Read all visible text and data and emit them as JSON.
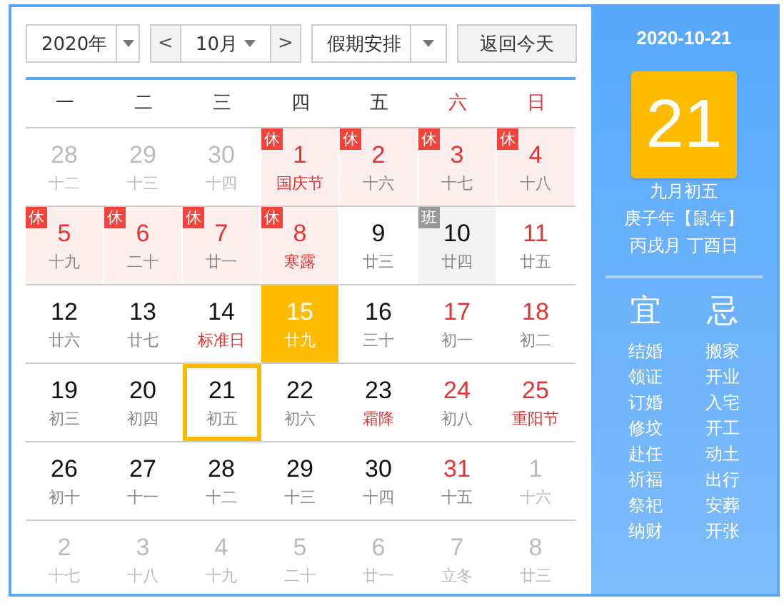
{
  "toolbar": {
    "year": "2020年",
    "prev": "<",
    "month": "10月",
    "next": ">",
    "holiday_select": "假期安排",
    "today_button": "返回今天"
  },
  "weekdays": [
    {
      "label": "一",
      "weekend": false
    },
    {
      "label": "二",
      "weekend": false
    },
    {
      "label": "三",
      "weekend": false
    },
    {
      "label": "四",
      "weekend": false
    },
    {
      "label": "五",
      "weekend": false
    },
    {
      "label": "六",
      "weekend": true
    },
    {
      "label": "日",
      "weekend": true
    }
  ],
  "weeks": [
    [
      {
        "day": "28",
        "lunar": "十二",
        "muted": true,
        "today": false,
        "selected": false
      },
      {
        "day": "29",
        "lunar": "十三",
        "muted": true,
        "today": false,
        "selected": false
      },
      {
        "day": "30",
        "lunar": "十四",
        "muted": true,
        "today": false,
        "selected": false
      },
      {
        "day": "1",
        "lunar": "国庆节",
        "muted": false,
        "rest_day": true,
        "festival": true,
        "badge": {
          "kind": "rest",
          "text": "休"
        },
        "today": false,
        "selected": false
      },
      {
        "day": "2",
        "lunar": "十六",
        "muted": false,
        "rest_day": true,
        "festival": false,
        "badge": {
          "kind": "rest",
          "text": "休"
        },
        "today": false,
        "selected": false
      },
      {
        "day": "3",
        "lunar": "十七",
        "muted": false,
        "rest_day": true,
        "festival": false,
        "badge": {
          "kind": "rest",
          "text": "休"
        },
        "today": false,
        "selected": false
      },
      {
        "day": "4",
        "lunar": "十八",
        "muted": false,
        "rest_day": true,
        "festival": false,
        "badge": {
          "kind": "rest",
          "text": "休"
        },
        "today": false,
        "selected": false
      }
    ],
    [
      {
        "day": "5",
        "lunar": "十九",
        "muted": false,
        "rest_day": true,
        "festival": false,
        "badge": {
          "kind": "rest",
          "text": "休"
        },
        "today": false,
        "selected": false
      },
      {
        "day": "6",
        "lunar": "二十",
        "muted": false,
        "rest_day": true,
        "festival": false,
        "badge": {
          "kind": "rest",
          "text": "休"
        },
        "today": false,
        "selected": false
      },
      {
        "day": "7",
        "lunar": "廿一",
        "muted": false,
        "rest_day": true,
        "festival": false,
        "badge": {
          "kind": "rest",
          "text": "休"
        },
        "today": false,
        "selected": false
      },
      {
        "day": "8",
        "lunar": "寒露",
        "muted": false,
        "rest_day": true,
        "festival": true,
        "badge": {
          "kind": "rest",
          "text": "休"
        },
        "today": false,
        "selected": false
      },
      {
        "day": "9",
        "lunar": "廿三",
        "muted": false,
        "rest_day": false,
        "festival": false,
        "today": false,
        "selected": false
      },
      {
        "day": "10",
        "lunar": "廿四",
        "muted": false,
        "rest_day": false,
        "festival": false,
        "badge": {
          "kind": "work",
          "text": "班"
        },
        "today": false,
        "selected": false
      },
      {
        "day": "11",
        "lunar": "廿五",
        "muted": false,
        "rest_day": true,
        "festival": false,
        "today": false,
        "selected": false
      }
    ],
    [
      {
        "day": "12",
        "lunar": "廿六",
        "muted": false,
        "rest_day": false,
        "festival": false,
        "today": false,
        "selected": false
      },
      {
        "day": "13",
        "lunar": "廿七",
        "muted": false,
        "rest_day": false,
        "festival": false,
        "today": false,
        "selected": false
      },
      {
        "day": "14",
        "lunar": "标准日",
        "muted": false,
        "rest_day": false,
        "festival": true,
        "today": false,
        "selected": false
      },
      {
        "day": "15",
        "lunar": "廿九",
        "muted": false,
        "today": true,
        "selected": false
      },
      {
        "day": "16",
        "lunar": "三十",
        "muted": false,
        "rest_day": false,
        "festival": false,
        "today": false,
        "selected": false
      },
      {
        "day": "17",
        "lunar": "初一",
        "muted": false,
        "rest_day": true,
        "festival": false,
        "today": false,
        "selected": false
      },
      {
        "day": "18",
        "lunar": "初二",
        "muted": false,
        "rest_day": true,
        "festival": false,
        "today": false,
        "selected": false
      }
    ],
    [
      {
        "day": "19",
        "lunar": "初三",
        "muted": false,
        "rest_day": false,
        "festival": false,
        "today": false,
        "selected": false
      },
      {
        "day": "20",
        "lunar": "初四",
        "muted": false,
        "rest_day": false,
        "festival": false,
        "today": false,
        "selected": false
      },
      {
        "day": "21",
        "lunar": "初五",
        "muted": false,
        "rest_day": false,
        "festival": false,
        "today": false,
        "selected": true
      },
      {
        "day": "22",
        "lunar": "初六",
        "muted": false,
        "rest_day": false,
        "festival": false,
        "today": false,
        "selected": false
      },
      {
        "day": "23",
        "lunar": "霜降",
        "muted": false,
        "rest_day": false,
        "festival": true,
        "today": false,
        "selected": false
      },
      {
        "day": "24",
        "lunar": "初八",
        "muted": false,
        "rest_day": true,
        "festival": false,
        "today": false,
        "selected": false
      },
      {
        "day": "25",
        "lunar": "重阳节",
        "muted": false,
        "rest_day": true,
        "festival": true,
        "today": false,
        "selected": false
      }
    ],
    [
      {
        "day": "26",
        "lunar": "初十",
        "muted": false,
        "rest_day": false,
        "festival": false,
        "today": false,
        "selected": false
      },
      {
        "day": "27",
        "lunar": "十一",
        "muted": false,
        "rest_day": false,
        "festival": false,
        "today": false,
        "selected": false
      },
      {
        "day": "28",
        "lunar": "十二",
        "muted": false,
        "rest_day": false,
        "festival": false,
        "today": false,
        "selected": false
      },
      {
        "day": "29",
        "lunar": "十三",
        "muted": false,
        "rest_day": false,
        "festival": false,
        "today": false,
        "selected": false
      },
      {
        "day": "30",
        "lunar": "十四",
        "muted": false,
        "rest_day": false,
        "festival": false,
        "today": false,
        "selected": false
      },
      {
        "day": "31",
        "lunar": "十五",
        "muted": false,
        "rest_day": true,
        "festival": false,
        "today": false,
        "selected": false
      },
      {
        "day": "1",
        "lunar": "十六",
        "muted": true,
        "today": false,
        "selected": false
      }
    ],
    [
      {
        "day": "2",
        "lunar": "十七",
        "muted": true,
        "today": false,
        "selected": false
      },
      {
        "day": "3",
        "lunar": "十八",
        "muted": true,
        "today": false,
        "selected": false
      },
      {
        "day": "4",
        "lunar": "十九",
        "muted": true,
        "today": false,
        "selected": false
      },
      {
        "day": "5",
        "lunar": "二十",
        "muted": true,
        "today": false,
        "selected": false
      },
      {
        "day": "6",
        "lunar": "廿一",
        "muted": true,
        "today": false,
        "selected": false
      },
      {
        "day": "7",
        "lunar": "立冬",
        "muted": true,
        "today": false,
        "selected": false
      },
      {
        "day": "8",
        "lunar": "廿三",
        "muted": true,
        "today": false,
        "selected": false
      }
    ]
  ],
  "sidebar": {
    "date": "2020-10-21",
    "big_day": "21",
    "lunar_date": "九月初五",
    "year_line": "庚子年【鼠年】",
    "month_day_line": "丙戌月 丁酉日",
    "good_title": "宜",
    "good": [
      "结婚",
      "领证",
      "订婚",
      "修坟",
      "赴任",
      "祈福",
      "祭祀",
      "纳财"
    ],
    "bad_title": "忌",
    "bad": [
      "搬家",
      "开业",
      "入宅",
      "开工",
      "动土",
      "出行",
      "安葬",
      "开张"
    ]
  }
}
